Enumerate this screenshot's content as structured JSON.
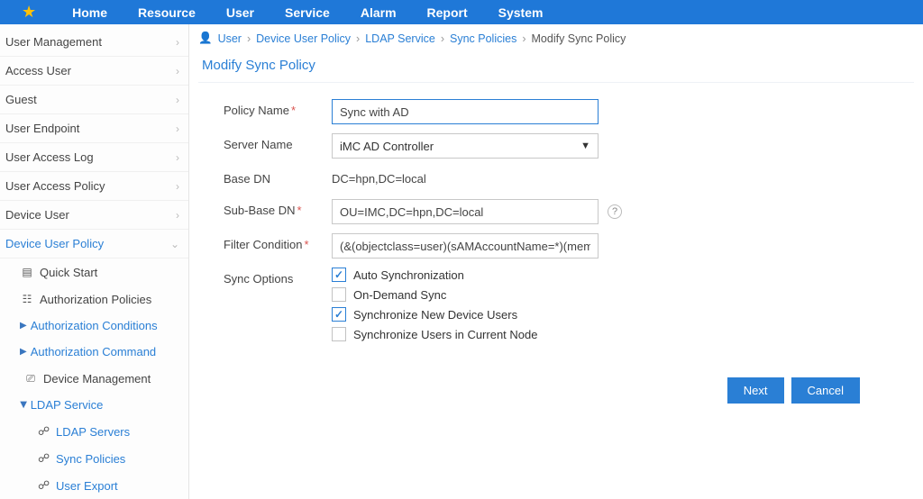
{
  "topnav": {
    "items": [
      "Home",
      "Resource",
      "User",
      "Service",
      "Alarm",
      "Report",
      "System"
    ]
  },
  "sidebar": {
    "top": [
      "User Management",
      "Access User",
      "Guest",
      "User Endpoint",
      "User Access Log",
      "User Access Policy",
      "Device User"
    ],
    "activeSection": "Device User Policy",
    "quickStart": "Quick Start",
    "authPolicies": "Authorization Policies",
    "authConditions": "Authorization Conditions",
    "authCommand": "Authorization Command",
    "deviceMgmt": "Device Management",
    "ldapService": "LDAP Service",
    "ldapServers": "LDAP Servers",
    "syncPolicies": "Sync Policies",
    "userExport": "User Export"
  },
  "breadcrumb": {
    "items": [
      "User",
      "Device User Policy",
      "LDAP Service",
      "Sync Policies"
    ],
    "current": "Modify Sync Policy"
  },
  "panel": {
    "title": "Modify Sync Policy"
  },
  "form": {
    "policyName_label": "Policy Name",
    "policyName_value": "Sync with AD",
    "serverName_label": "Server Name",
    "serverName_value": "iMC AD Controller",
    "baseDN_label": "Base DN",
    "baseDN_value": "DC=hpn,DC=local",
    "subBaseDN_label": "Sub-Base DN",
    "subBaseDN_value": "OU=IMC,DC=hpn,DC=local",
    "filter_label": "Filter Condition",
    "filter_value": "(&(objectclass=user)(sAMAccountName=*)(memberOf",
    "syncOptions_label": "Sync Options",
    "options": [
      {
        "label": "Auto Synchronization",
        "checked": true
      },
      {
        "label": "On-Demand Sync",
        "checked": false
      },
      {
        "label": "Synchronize New Device Users",
        "checked": true
      },
      {
        "label": "Synchronize Users in Current Node",
        "checked": false
      }
    ]
  },
  "buttons": {
    "next": "Next",
    "cancel": "Cancel"
  }
}
